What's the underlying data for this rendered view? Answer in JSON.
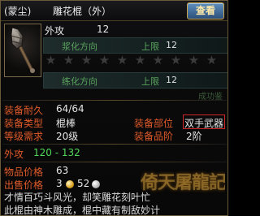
{
  "header": {
    "prefix": "(蒙尘)",
    "item_name": "雕花棍（外）",
    "view_button": "查看"
  },
  "top_attr": {
    "label": "外攻",
    "value": "12"
  },
  "slots": [
    {
      "label": "浆化方向",
      "upper_label": "上限",
      "upper_value": "12",
      "stars_filled": 0,
      "stars_total": 10
    },
    {
      "label": "练化方向",
      "upper_label": "上限",
      "upper_value": "12"
    }
  ],
  "faded_note": "成功鉴",
  "properties": {
    "durability": {
      "label": "装备耐久",
      "value": "64/64"
    },
    "type": {
      "label": "装备类型",
      "value": "棍棒"
    },
    "level_req": {
      "label": "等级需求",
      "value": "20级"
    },
    "slot": {
      "label": "装备部位",
      "value": "双手武器"
    },
    "grade": {
      "label": "装备品阶",
      "value": "2阶"
    },
    "attack": {
      "label": "外攻",
      "value": "120 - 132"
    },
    "item_price": {
      "label": "物品价格",
      "value": "63"
    },
    "auction_price": {
      "label": "出售价格",
      "gold": "3",
      "silver": "52"
    }
  },
  "watermark": "倚天屠龍記",
  "description": [
    "才情百巧斗风光，却笑雕花刻叶忙",
    "此棍由神木雕成，棍中藏有制敌妙计"
  ],
  "colors": {
    "label_orange": "#e05a2a",
    "value_green": "#52d85a",
    "slot_green": "#5aa35c",
    "border_gold": "#6b5a3a",
    "highlight_red": "#d02828"
  }
}
